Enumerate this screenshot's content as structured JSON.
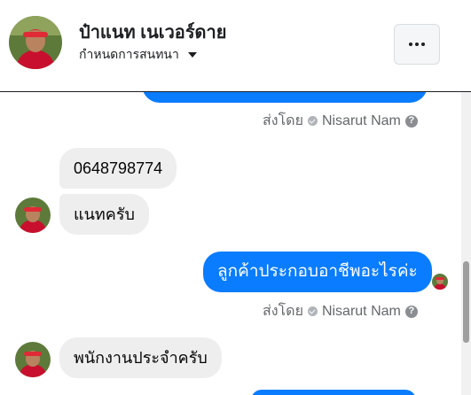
{
  "header": {
    "contact_name": "ป๋าแนท เนเวอร์ดาย",
    "subtitle": "กำหนดการสนทนา"
  },
  "messages": {
    "sent_by_1": {
      "prefix": "ส่งโดย",
      "name": "Nisarut Nam",
      "help": "?"
    },
    "in_1": "0648798774",
    "in_2": "แนทครับ",
    "out_1": "ลูกค้าประกอบอาชีพอะไรค่ะ",
    "sent_by_2": {
      "prefix": "ส่งโดย",
      "name": "Nisarut Nam",
      "help": "?"
    },
    "in_3": "พนักงานประจำครับ"
  },
  "colors": {
    "outgoing_bubble": "#0a7cff",
    "incoming_bubble": "#eeeeee",
    "meta_text": "#65676b"
  },
  "icons": {
    "more": "more-horizontal-icon",
    "caret": "caret-down-icon",
    "verified": "check-circle-icon",
    "help": "question-circle-icon"
  }
}
